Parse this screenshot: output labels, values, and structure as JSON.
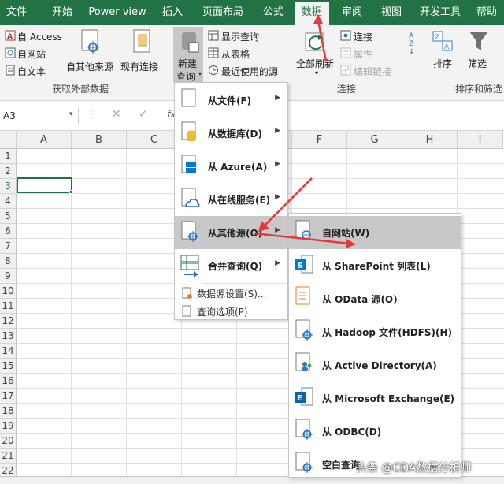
{
  "tabs": [
    "文件",
    "开始",
    "Power view",
    "插入",
    "页面布局",
    "公式",
    "数据",
    "审阅",
    "视图",
    "开发工具",
    "帮助"
  ],
  "ribbon": {
    "get_external": {
      "access": "自 Access",
      "web": "自网站",
      "text": "自文本",
      "other_sources": "自其他来源",
      "existing_connections": "现有连接",
      "group_label": "获取外部数据"
    },
    "get_transform": {
      "new_query_line1": "新建",
      "new_query_line2": "查询",
      "show_queries": "显示查询",
      "from_table": "从表格",
      "recent_sources": "最近使用的源"
    },
    "connections": {
      "refresh_all": "全部刷新",
      "connections": "连接",
      "properties": "属性",
      "edit_links": "编辑链接",
      "group_label": "连接"
    },
    "sort_filter": {
      "sort": "排序",
      "filter": "筛选",
      "group_label": "排序和筛选"
    }
  },
  "formula_bar": {
    "name_box": "A3"
  },
  "grid": {
    "columns": [
      "A",
      "B",
      "C",
      "D",
      "E",
      "F",
      "G",
      "H",
      "I"
    ],
    "rows": [
      "1",
      "2",
      "3",
      "4",
      "5",
      "6",
      "7",
      "8",
      "9",
      "10",
      "11",
      "12",
      "13",
      "14",
      "15",
      "16",
      "17",
      "18",
      "19",
      "20",
      "21",
      "22"
    ]
  },
  "menu_new_query": [
    {
      "label": "从文件(F)",
      "icon": "file-icon"
    },
    {
      "label": "从数据库(D)",
      "icon": "database-icon"
    },
    {
      "label": "从 Azure(A)",
      "icon": "azure-icon"
    },
    {
      "label": "从在线服务(E)",
      "icon": "cloud-icon"
    },
    {
      "label": "从其他源(O)",
      "icon": "other-source-icon"
    },
    {
      "label": "合并查询(Q)",
      "icon": "combine-icon"
    }
  ],
  "menu_new_query_small": [
    {
      "label": "数据源设置(S)...",
      "icon": "settings-icon"
    },
    {
      "label": "查询选项(P)",
      "icon": "options-icon"
    }
  ],
  "menu_other_sources": [
    {
      "label": "自网站(W)",
      "icon": "web-page-icon"
    },
    {
      "label": "从 SharePoint 列表(L)",
      "icon": "sharepoint-icon"
    },
    {
      "label": "从 OData 源(O)",
      "icon": "odata-icon"
    },
    {
      "label": "从 Hadoop 文件(HDFS)(H)",
      "icon": "hadoop-icon"
    },
    {
      "label": "从 Active Directory(A)",
      "icon": "active-directory-icon"
    },
    {
      "label": "从 Microsoft Exchange(E)",
      "icon": "exchange-icon"
    },
    {
      "label": "从 ODBC(D)",
      "icon": "odbc-icon"
    },
    {
      "label": "空白查询",
      "icon": "blank-query-icon"
    }
  ],
  "watermark": "头条 @CDA数据分析师",
  "colors": {
    "excel_green": "#217346",
    "arrow_red": "#e8383d",
    "highlight": "#c8c8c8"
  }
}
